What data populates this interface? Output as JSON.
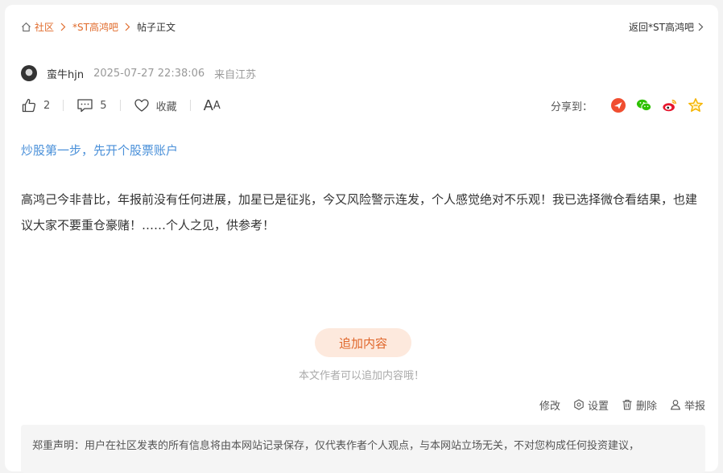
{
  "breadcrumb": {
    "home_label": "社区",
    "bar_label": "*ST高鸿吧",
    "current_label": "帖子正文",
    "back_label": "返回*ST高鸿吧"
  },
  "author": {
    "name": "蛮牛hjn",
    "time": "2025-07-27 22:38:06",
    "from": "来自江苏"
  },
  "actions": {
    "like_count": "2",
    "comment_count": "5",
    "favorite_label": "收藏",
    "font_big": "A",
    "font_small": "A"
  },
  "share": {
    "label": "分享到：",
    "colors": {
      "toutiao": "#f04e30",
      "wechat": "#2dc100",
      "weibo": "#e6162d",
      "favorite": "#f5b400"
    }
  },
  "promo": {
    "text": "炒股第一步，先开个股票账户"
  },
  "post": {
    "body": "高鸿己今非昔比，年报前没有任何进展，加星已是征兆，今又风险警示连发，个人感觉绝对不乐观！我已选择微仓看结果，也建议大家不要重仓豪赌！……个人之见，供参考！"
  },
  "append": {
    "button_label": "追加内容",
    "hint": "本文作者可以追加内容哦！"
  },
  "manage": {
    "edit_label": "修改",
    "settings_label": "设置",
    "delete_label": "删除",
    "report_label": "举报"
  },
  "disclaimer": {
    "text": "郑重声明：用户在社区发表的所有信息将由本网站记录保存，仅代表作者个人观点，与本网站立场无关，不对您构成任何投资建议，"
  },
  "theme": {
    "accent": "#e06a2a",
    "link": "#4a90d9"
  }
}
